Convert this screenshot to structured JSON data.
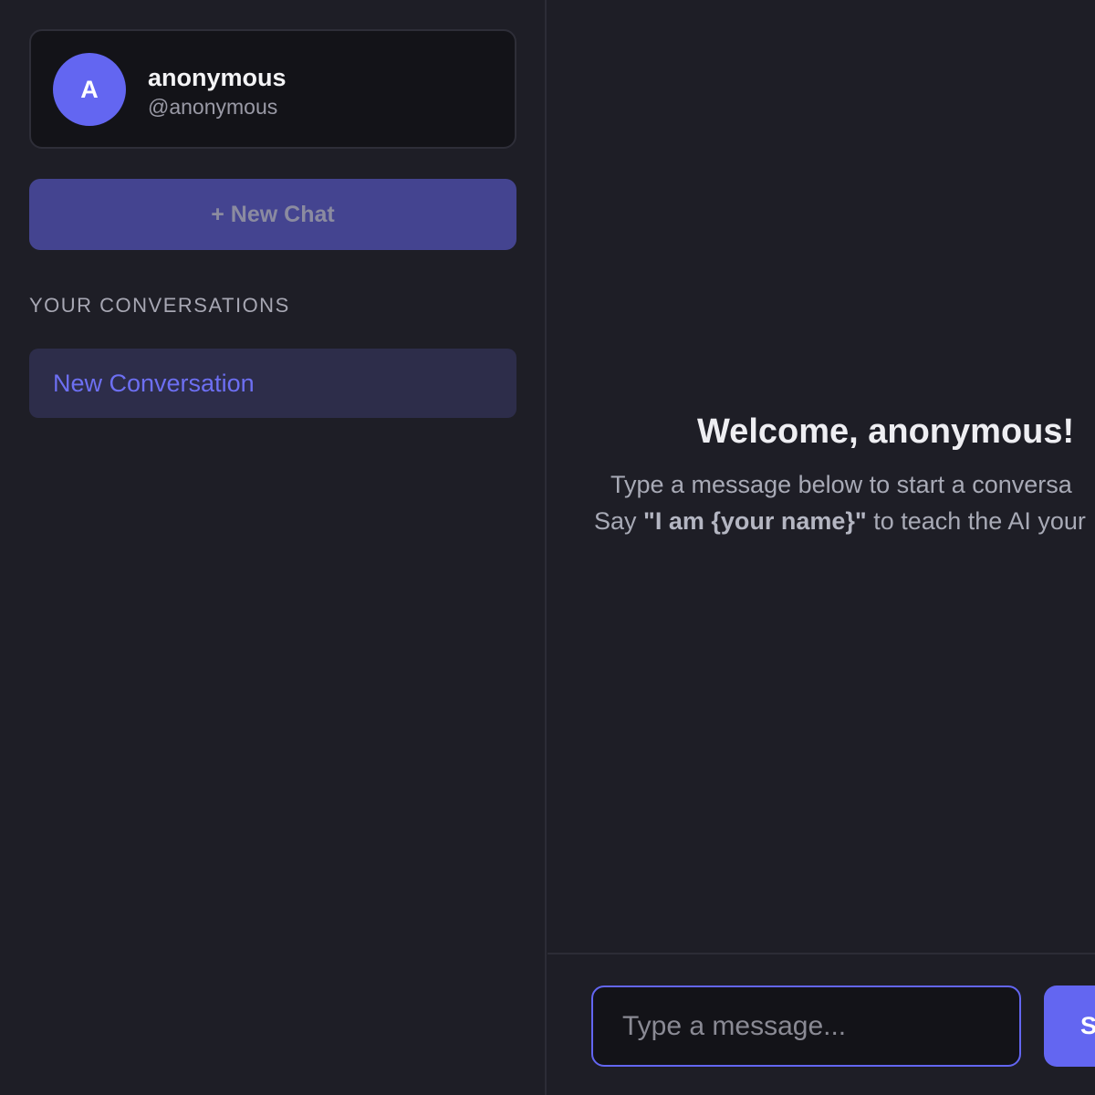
{
  "profile": {
    "avatar_initial": "A",
    "name": "anonymous",
    "handle": "@anonymous"
  },
  "sidebar": {
    "new_chat_label": "+ New Chat",
    "section_label": "YOUR CONVERSATIONS",
    "conversations": [
      {
        "label": "New Conversation",
        "active": true
      }
    ]
  },
  "main": {
    "welcome_title": "Welcome, anonymous!",
    "welcome_line1": "Type a message below to start a conversa",
    "welcome_line2_prefix": "Say ",
    "welcome_line2_strong": "\"I am {your name}\"",
    "welcome_line2_suffix": " to teach the AI your"
  },
  "composer": {
    "placeholder": "Type a message...",
    "value": "",
    "send_label": "S"
  },
  "colors": {
    "accent": "#6366f1",
    "background": "#1e1e26",
    "card": "#131318",
    "new_chat_button": "#444490",
    "active_conversation": "#2d2d4a"
  },
  "icons": []
}
